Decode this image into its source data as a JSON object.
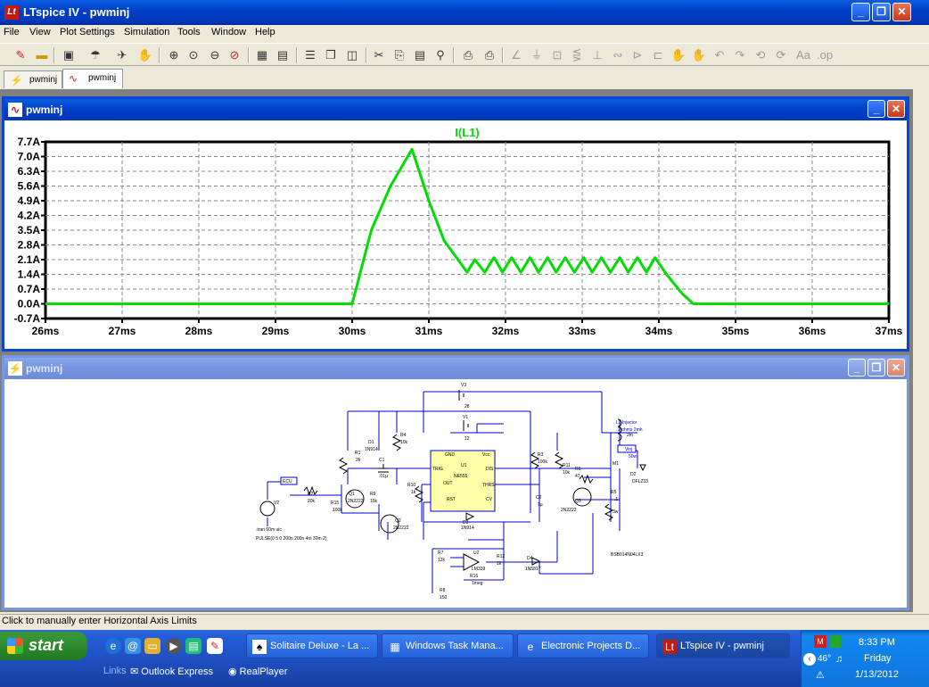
{
  "window": {
    "title": "LTspice IV - pwminj",
    "minimize": "_",
    "restore": "❐",
    "close": "✕"
  },
  "menu": [
    "File",
    "View",
    "Plot Settings",
    "Simulation",
    "Tools",
    "Window",
    "Help"
  ],
  "tabs": [
    {
      "label": "pwminj",
      "icon": "schematic-icon"
    },
    {
      "label": "pwminj",
      "icon": "waveform-icon"
    }
  ],
  "plot_window": {
    "title": "pwminj"
  },
  "schematic_window": {
    "title": "pwminj"
  },
  "chart_data": {
    "type": "line",
    "title": "I(L1)",
    "xlabel": "",
    "ylabel": "",
    "x_ticks": [
      "26ms",
      "27ms",
      "28ms",
      "29ms",
      "30ms",
      "31ms",
      "32ms",
      "33ms",
      "34ms",
      "35ms",
      "36ms",
      "37ms"
    ],
    "y_ticks": [
      "7.7A",
      "7.0A",
      "6.3A",
      "5.6A",
      "4.9A",
      "4.2A",
      "3.5A",
      "2.8A",
      "2.1A",
      "1.4A",
      "0.7A",
      "0.0A",
      "-0.7A"
    ],
    "xlim": [
      26,
      37
    ],
    "ylim": [
      -0.7,
      7.7
    ],
    "grid": true,
    "series": [
      {
        "name": "I(L1)",
        "color": "#00dd00",
        "x": [
          26,
          30.0,
          30.25,
          30.5,
          30.78,
          31.0,
          31.2,
          31.4,
          31.5,
          31.6,
          31.73,
          31.85,
          31.96,
          32.08,
          32.2,
          32.32,
          32.43,
          32.55,
          32.66,
          32.78,
          32.9,
          33.02,
          33.13,
          33.25,
          33.37,
          33.49,
          33.6,
          33.72,
          33.84,
          33.95,
          34.1,
          34.3,
          34.45,
          37
        ],
        "y": [
          0,
          0,
          3.5,
          5.6,
          7.35,
          4.9,
          3.0,
          2.0,
          1.5,
          2.1,
          1.5,
          2.2,
          1.5,
          2.2,
          1.5,
          2.2,
          1.5,
          2.2,
          1.5,
          2.2,
          1.5,
          2.2,
          1.5,
          2.2,
          1.5,
          2.2,
          1.5,
          2.2,
          1.5,
          2.2,
          1.4,
          0.5,
          0,
          0
        ]
      }
    ]
  },
  "schematic": {
    "labels": [
      "V3",
      "28",
      "V1",
      "12",
      "GND",
      "Vcc",
      "TRIG",
      "DIS",
      "OUT",
      "THRS",
      "RST",
      "CV",
      "U1",
      "NE555",
      "R1",
      "2k",
      "D1",
      "1N914",
      "C1",
      ".01µ",
      "R4",
      "10k",
      "R3",
      "100k",
      "R11",
      "10k",
      "R6",
      "47",
      "M1",
      "Vinj",
      "50w",
      "L1 Injector",
      "2 ohms 2mh",
      "2m",
      "D2",
      "DFLZ33",
      "R5",
      ".1",
      "3w",
      "R10",
      "1k",
      "C2",
      "1µ",
      "Q3",
      "2N2222",
      "D3",
      "1N914",
      "Q1",
      "2N2222",
      "R2",
      "20k",
      "R15",
      "100k",
      "R9",
      "15k",
      "Q2",
      "2N2222",
      "ECU",
      "V2",
      ".tran 60m uic",
      "PULSE(0 5 0 200n 200n 4m 30m 2)",
      "R7",
      "12k",
      "U2",
      "LM339",
      "R12",
      "1k",
      "D4",
      "1N5817",
      "R16",
      "1meg",
      "R8",
      "150",
      "BSB014N04LX3"
    ]
  },
  "status": "Click to manually enter Horizontal Axis Limits",
  "taskbar": {
    "start": "start",
    "tasks": [
      {
        "label": "Solitaire Deluxe - La ...",
        "icon": "solitaire-icon"
      },
      {
        "label": "Windows Task Mana...",
        "icon": "taskmanager-icon"
      },
      {
        "label": "Electronic Projects D...",
        "icon": "ie-icon"
      },
      {
        "label": "LTspice IV - pwminj",
        "icon": "ltspice-icon"
      }
    ],
    "links_label": "Links",
    "links": [
      "Outlook Express",
      "RealPlayer"
    ],
    "clock": {
      "time": "8:33 PM",
      "day": "Friday",
      "date": "1/13/2012"
    },
    "temp": "46°"
  }
}
